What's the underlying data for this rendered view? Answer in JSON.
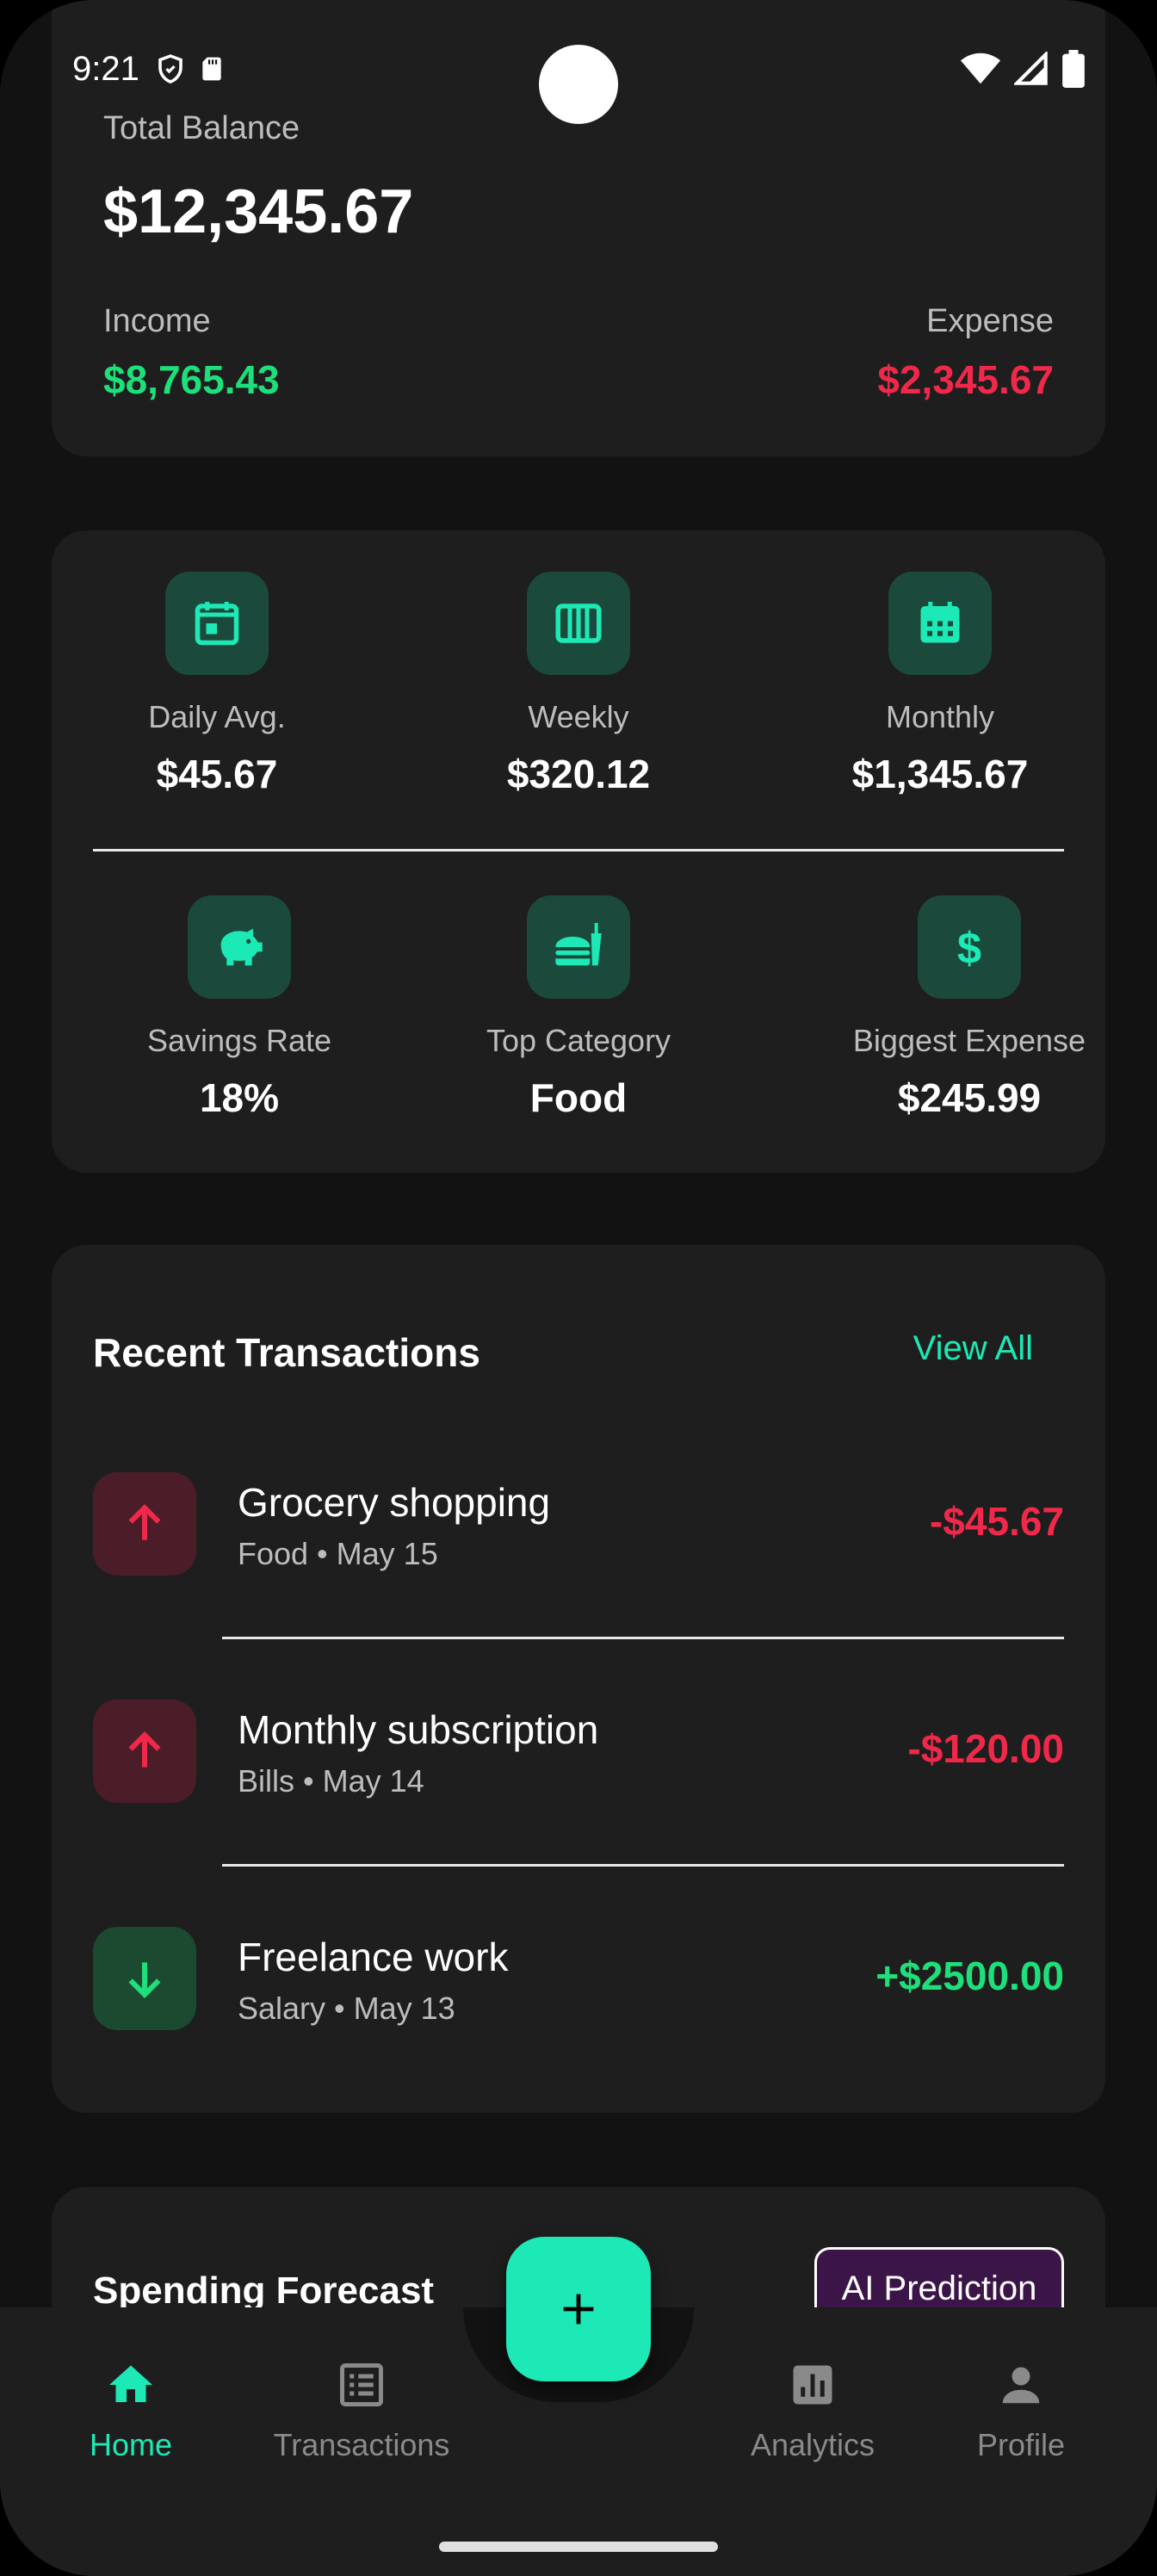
{
  "status_bar": {
    "time": "9:21"
  },
  "balance": {
    "total_label": "Total Balance",
    "total_value": "$12,345.67",
    "income_label": "Income",
    "income_value": "$8,765.43",
    "expense_label": "Expense",
    "expense_value": "$2,345.67"
  },
  "stats": [
    {
      "icon": "calendar-day-icon",
      "label": "Daily Avg.",
      "value": "$45.67"
    },
    {
      "icon": "calendar-week-icon",
      "label": "Weekly",
      "value": "$320.12"
    },
    {
      "icon": "calendar-month-icon",
      "label": "Monthly",
      "value": "$1,345.67"
    },
    {
      "icon": "piggy-bank-icon",
      "label": "Savings Rate",
      "value": "18%"
    },
    {
      "icon": "fastfood-icon",
      "label": "Top Category",
      "value": "Food"
    },
    {
      "icon": "dollar-icon",
      "label": "Biggest Expense",
      "value": "$245.99"
    }
  ],
  "transactions": {
    "title": "Recent Transactions",
    "view_all": "View All",
    "items": [
      {
        "title": "Grocery shopping",
        "subtitle": "Food • May 15",
        "amount": "-$45.67",
        "type": "expense"
      },
      {
        "title": "Monthly subscription",
        "subtitle": "Bills • May 14",
        "amount": "-$120.00",
        "type": "expense"
      },
      {
        "title": "Freelance work",
        "subtitle": "Salary • May 13",
        "amount": "+$2500.00",
        "type": "income"
      }
    ]
  },
  "forecast": {
    "title": "Spending Forecast",
    "badge": "AI Prediction"
  },
  "nav": {
    "items": [
      {
        "label": "Home",
        "icon": "home-icon",
        "active": true
      },
      {
        "label": "Transactions",
        "icon": "receipt-icon",
        "active": false
      },
      {
        "label": "Analytics",
        "icon": "analytics-icon",
        "active": false
      },
      {
        "label": "Profile",
        "icon": "person-icon",
        "active": false
      }
    ],
    "fab_icon": "plus-icon"
  },
  "colors": {
    "accent": "#1de9b6",
    "income": "#1de07a",
    "expense": "#f0284a",
    "card": "#1e1e1e",
    "background": "#121212"
  }
}
